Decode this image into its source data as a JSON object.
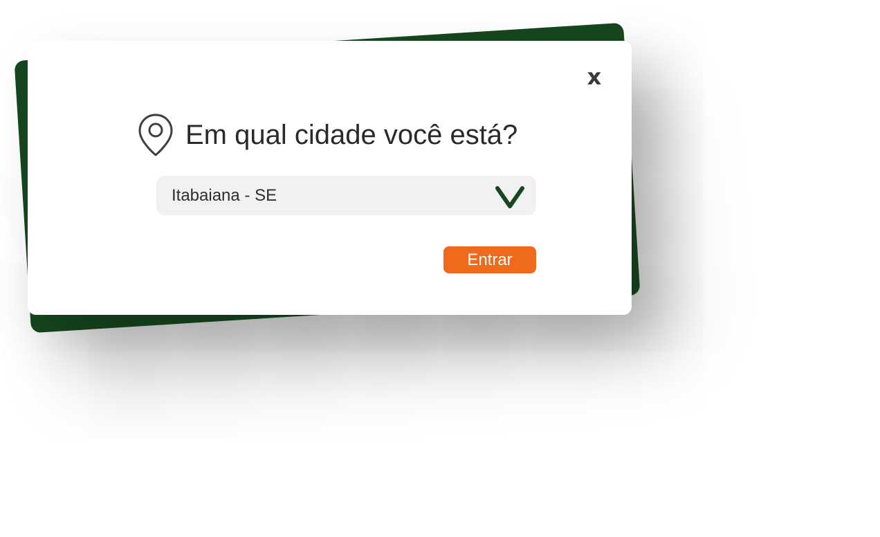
{
  "modal": {
    "close_label": "x",
    "title": "Em qual cidade você está?",
    "title_icon": "map-pin-icon",
    "city_select": {
      "selected": "Itabaiana - SE",
      "icon": "chevron-down-icon"
    },
    "enter_label": "Entrar"
  },
  "colors": {
    "back_card": "#16471f",
    "accent_button": "#ef6a1c",
    "select_background": "#f1f1f1",
    "chevron": "#16471f",
    "text": "#2a2a2a"
  }
}
